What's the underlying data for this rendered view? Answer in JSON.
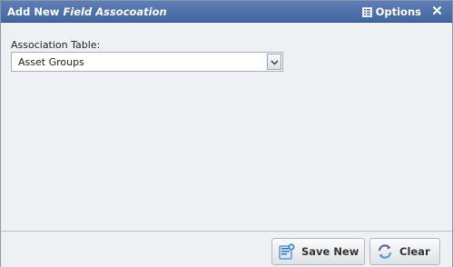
{
  "window": {
    "title_prefix": "Add New",
    "title_emphasis": "Field Assocoation",
    "options_label": "Options"
  },
  "form": {
    "association_label": "Association Table:",
    "association_value": "Asset Groups"
  },
  "footer": {
    "save_label": "Save New",
    "clear_label": "Clear"
  },
  "colors": {
    "titlebar": "#4b6ea8",
    "accent": "#2f6fb5"
  }
}
